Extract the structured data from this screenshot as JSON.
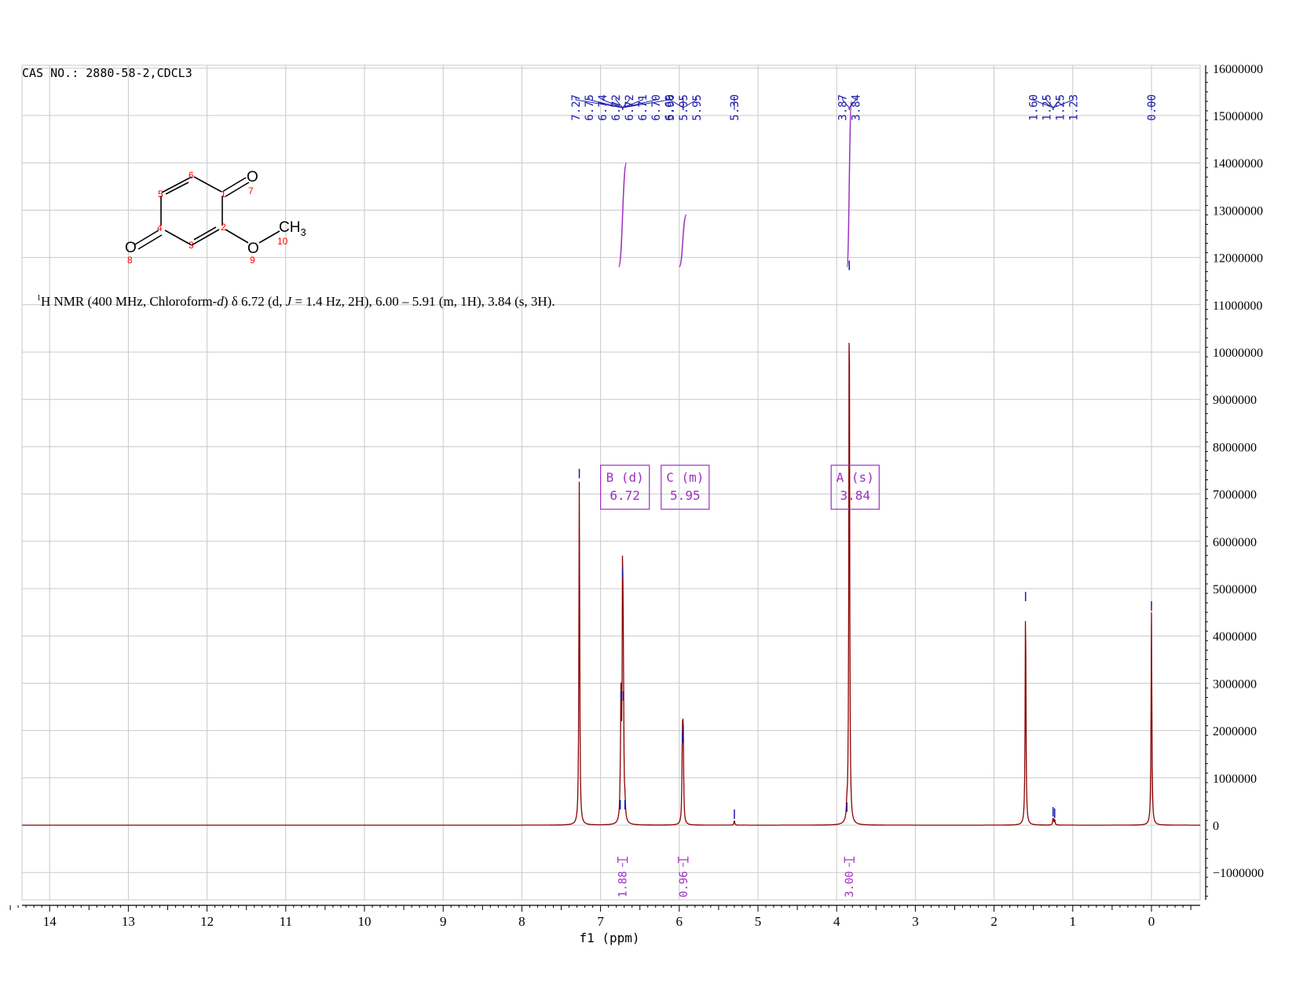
{
  "header": {
    "cas_label": "CAS NO.: 2880-58-2,CDCL3"
  },
  "description": {
    "superscript": "1",
    "prefix": "H NMR (400 MHz, Chloroform-",
    "d": "d",
    "middle": ") δ 6.72 (d, ",
    "j": "J",
    "suffix": " = 1.4 Hz, 2H), 6.00 – 5.91 (m, 1H), 3.84 (s, 3H)."
  },
  "molecule": {
    "atom_labels": [
      {
        "id": "o7",
        "text": "O"
      },
      {
        "id": "o8",
        "text": "O"
      },
      {
        "id": "o9",
        "text": "O"
      },
      {
        "id": "ch3",
        "text": "CH"
      },
      {
        "id": "ch3sub",
        "text": "3"
      }
    ],
    "numbers": [
      "1",
      "2",
      "3",
      "4",
      "5",
      "6",
      "7",
      "8",
      "9",
      "10"
    ],
    "label_color": "#ff0000"
  },
  "chart_data": {
    "type": "line",
    "xlabel": "f1 (ppm)",
    "ylabel": "",
    "xlim": [
      14.5,
      -0.5
    ],
    "ylim": [
      -1500000,
      16000000
    ],
    "x_ticks": [
      14,
      13,
      12,
      11,
      10,
      9,
      8,
      7,
      6,
      5,
      4,
      3,
      2,
      1,
      0
    ],
    "y_ticks": [
      16000000,
      15000000,
      14000000,
      13000000,
      12000000,
      11000000,
      10000000,
      9000000,
      8000000,
      7000000,
      6000000,
      5000000,
      4000000,
      3000000,
      2000000,
      1000000,
      0,
      -1000000
    ],
    "y_tick_labels": [
      "16000000",
      "15000000",
      "14000000",
      "13000000",
      "12000000",
      "11000000",
      "10000000",
      "9000000",
      "8000000",
      "7000000",
      "6000000",
      "5000000",
      "4000000",
      "3000000",
      "2000000",
      "1000000",
      "0",
      "−1000000"
    ],
    "grid": true,
    "spectrum_color": "#8b0000",
    "peak_label_color": "#1a1aa8",
    "integral_color": "#9b30c0",
    "peaks": [
      {
        "ppm": 7.27,
        "height": 7300000
      },
      {
        "ppm": 6.75,
        "height": 300000
      },
      {
        "ppm": 6.74,
        "height": 2600000
      },
      {
        "ppm": 6.72,
        "height": 5200000
      },
      {
        "ppm": 6.71,
        "height": 2600000
      },
      {
        "ppm": 6.69,
        "height": 300000
      },
      {
        "ppm": 5.96,
        "height": 1700000
      },
      {
        "ppm": 5.95,
        "height": 1900000
      },
      {
        "ppm": 5.3,
        "height": 100000
      },
      {
        "ppm": 3.87,
        "height": 250000
      },
      {
        "ppm": 3.84,
        "height": 11700000
      },
      {
        "ppm": 1.6,
        "height": 4700000
      },
      {
        "ppm": 1.25,
        "height": 150000
      },
      {
        "ppm": 1.23,
        "height": 120000
      },
      {
        "ppm": 0.0,
        "height": 4500000
      }
    ],
    "peak_label_groups": [
      {
        "labels": [
          "7.27",
          "6.75",
          "6.74",
          "6.72",
          "6.72",
          "6.71",
          "6.70",
          "6.69"
        ],
        "target_ppm": 6.72
      },
      {
        "labels": [
          "5.96",
          "5.95",
          "5.95"
        ],
        "target_ppm": 5.95
      },
      {
        "labels": [
          "5.30"
        ],
        "target_ppm": 5.3
      },
      {
        "labels": [
          "3.87",
          "3.84"
        ],
        "target_ppm": 3.84
      },
      {
        "labels": [
          "1.60",
          "1.25",
          "1.25",
          "1.23"
        ],
        "target_ppm": 1.25
      },
      {
        "labels": [
          "0.00"
        ],
        "target_ppm": 0.0
      }
    ],
    "integral_curves": [
      {
        "from_ppm": 6.77,
        "to_ppm": 6.67,
        "y_start": 11800000,
        "y_end": 14000000
      },
      {
        "from_ppm": 6.0,
        "to_ppm": 5.91,
        "y_start": 11800000,
        "y_end": 12900000
      },
      {
        "from_ppm": 3.87,
        "to_ppm": 3.81,
        "y_start": 11800000,
        "y_end": 15300000
      }
    ],
    "multiplets": [
      {
        "letter": "B",
        "type": "(d)",
        "shift": "6.72",
        "ppm_from": 7.0,
        "ppm_to": 6.38
      },
      {
        "letter": "C",
        "type": "(m)",
        "shift": "5.95",
        "ppm_from": 6.23,
        "ppm_to": 5.62
      },
      {
        "letter": "A",
        "type": "(s)",
        "shift": "3.84",
        "ppm_from": 4.07,
        "ppm_to": 3.46
      }
    ],
    "integrations": [
      {
        "value": "1.88",
        "ppm": 6.72
      },
      {
        "value": "0.96",
        "ppm": 5.95
      },
      {
        "value": "3.00",
        "ppm": 3.84
      }
    ]
  }
}
